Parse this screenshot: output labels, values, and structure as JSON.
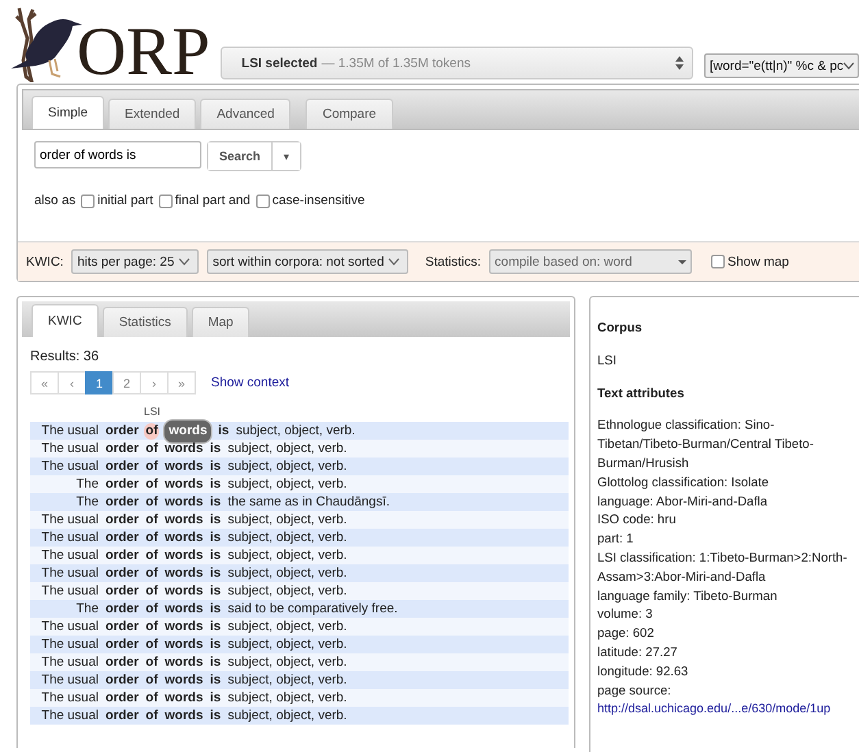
{
  "logo": {
    "text": "ORP"
  },
  "corpus_bar": {
    "selection": "LSI selected",
    "tokens": "— 1.35M of 1.35M tokens"
  },
  "query_select": {
    "value": "[word=\"e(tt|n)\" %c & pc"
  },
  "search_tabs": [
    {
      "label": "Simple",
      "selected": true
    },
    {
      "label": "Extended",
      "selected": false
    },
    {
      "label": "Advanced",
      "selected": false
    },
    {
      "label": "Compare",
      "selected": false
    }
  ],
  "search": {
    "value": "order of words is",
    "button": "Search",
    "caret": "▾"
  },
  "also_as": {
    "label": "also as",
    "options": [
      {
        "label": "initial part",
        "checked": false
      },
      {
        "label": "final part and",
        "checked": false
      },
      {
        "label": "case-insensitive",
        "checked": false
      }
    ]
  },
  "options_bar": {
    "kwic_label": "KWIC:",
    "hits_per_page": "hits per page: 25",
    "sort": "sort within corpora: not sorted",
    "statistics_label": "Statistics:",
    "compile": "compile based on: word",
    "show_map": {
      "label": "Show map",
      "checked": false
    }
  },
  "results_tabs": [
    {
      "label": "KWIC",
      "selected": true
    },
    {
      "label": "Statistics",
      "selected": false
    },
    {
      "label": "Map",
      "selected": false
    }
  ],
  "results": {
    "count": "Results: 36",
    "pages": [
      {
        "label": "«",
        "selected": false
      },
      {
        "label": "‹",
        "selected": false
      },
      {
        "label": "1",
        "selected": true
      },
      {
        "label": "2",
        "selected": false
      },
      {
        "label": "›",
        "selected": false
      },
      {
        "label": "»",
        "selected": false
      }
    ],
    "show_context": "Show context",
    "corpus_heading": "LSI",
    "rows": [
      {
        "left": "The usual",
        "match": [
          {
            "text": "order",
            "hovered": false,
            "selected": false
          },
          {
            "text": "of",
            "hovered": true,
            "selected": false
          },
          {
            "text": "words",
            "hovered": false,
            "selected": true
          },
          {
            "text": "is",
            "hovered": false,
            "selected": false
          }
        ],
        "right": "subject, object, verb."
      },
      {
        "left": "The usual",
        "match": [
          {
            "text": "order",
            "hovered": false,
            "selected": false
          },
          {
            "text": "of",
            "hovered": false,
            "selected": false
          },
          {
            "text": "words",
            "hovered": false,
            "selected": false
          },
          {
            "text": "is",
            "hovered": false,
            "selected": false
          }
        ],
        "right": "subject, object, verb."
      },
      {
        "left": "The usual",
        "match": [
          {
            "text": "order",
            "hovered": false,
            "selected": false
          },
          {
            "text": "of",
            "hovered": false,
            "selected": false
          },
          {
            "text": "words",
            "hovered": false,
            "selected": false
          },
          {
            "text": "is",
            "hovered": false,
            "selected": false
          }
        ],
        "right": "subject, object, verb."
      },
      {
        "left": "The",
        "match": [
          {
            "text": "order",
            "hovered": false,
            "selected": false
          },
          {
            "text": "of",
            "hovered": false,
            "selected": false
          },
          {
            "text": "words",
            "hovered": false,
            "selected": false
          },
          {
            "text": "is",
            "hovered": false,
            "selected": false
          }
        ],
        "right": "subject, object, verb."
      },
      {
        "left": "The",
        "match": [
          {
            "text": "order",
            "hovered": false,
            "selected": false
          },
          {
            "text": "of",
            "hovered": false,
            "selected": false
          },
          {
            "text": "words",
            "hovered": false,
            "selected": false
          },
          {
            "text": "is",
            "hovered": false,
            "selected": false
          }
        ],
        "right": "the same as in Chaudāngsī."
      },
      {
        "left": "The usual",
        "match": [
          {
            "text": "order",
            "hovered": false,
            "selected": false
          },
          {
            "text": "of",
            "hovered": false,
            "selected": false
          },
          {
            "text": "words",
            "hovered": false,
            "selected": false
          },
          {
            "text": "is",
            "hovered": false,
            "selected": false
          }
        ],
        "right": "subject, object, verb."
      },
      {
        "left": "The usual",
        "match": [
          {
            "text": "order",
            "hovered": false,
            "selected": false
          },
          {
            "text": "of",
            "hovered": false,
            "selected": false
          },
          {
            "text": "words",
            "hovered": false,
            "selected": false
          },
          {
            "text": "is",
            "hovered": false,
            "selected": false
          }
        ],
        "right": "subject, object, verb."
      },
      {
        "left": "The usual",
        "match": [
          {
            "text": "order",
            "hovered": false,
            "selected": false
          },
          {
            "text": "of",
            "hovered": false,
            "selected": false
          },
          {
            "text": "words",
            "hovered": false,
            "selected": false
          },
          {
            "text": "is",
            "hovered": false,
            "selected": false
          }
        ],
        "right": "subject, object, verb."
      },
      {
        "left": "The usual",
        "match": [
          {
            "text": "order",
            "hovered": false,
            "selected": false
          },
          {
            "text": "of",
            "hovered": false,
            "selected": false
          },
          {
            "text": "words",
            "hovered": false,
            "selected": false
          },
          {
            "text": "is",
            "hovered": false,
            "selected": false
          }
        ],
        "right": "subject, object, verb."
      },
      {
        "left": "The usual",
        "match": [
          {
            "text": "order",
            "hovered": false,
            "selected": false
          },
          {
            "text": "of",
            "hovered": false,
            "selected": false
          },
          {
            "text": "words",
            "hovered": false,
            "selected": false
          },
          {
            "text": "is",
            "hovered": false,
            "selected": false
          }
        ],
        "right": "subject, object, verb."
      },
      {
        "left": "The",
        "match": [
          {
            "text": "order",
            "hovered": false,
            "selected": false
          },
          {
            "text": "of",
            "hovered": false,
            "selected": false
          },
          {
            "text": "words",
            "hovered": false,
            "selected": false
          },
          {
            "text": "is",
            "hovered": false,
            "selected": false
          }
        ],
        "right": "said to be comparatively free."
      },
      {
        "left": "The usual",
        "match": [
          {
            "text": "order",
            "hovered": false,
            "selected": false
          },
          {
            "text": "of",
            "hovered": false,
            "selected": false
          },
          {
            "text": "words",
            "hovered": false,
            "selected": false
          },
          {
            "text": "is",
            "hovered": false,
            "selected": false
          }
        ],
        "right": "subject, object, verb."
      },
      {
        "left": "The usual",
        "match": [
          {
            "text": "order",
            "hovered": false,
            "selected": false
          },
          {
            "text": "of",
            "hovered": false,
            "selected": false
          },
          {
            "text": "words",
            "hovered": false,
            "selected": false
          },
          {
            "text": "is",
            "hovered": false,
            "selected": false
          }
        ],
        "right": "subject, object, verb."
      },
      {
        "left": "The usual",
        "match": [
          {
            "text": "order",
            "hovered": false,
            "selected": false
          },
          {
            "text": "of",
            "hovered": false,
            "selected": false
          },
          {
            "text": "words",
            "hovered": false,
            "selected": false
          },
          {
            "text": "is",
            "hovered": false,
            "selected": false
          }
        ],
        "right": "subject, object, verb."
      },
      {
        "left": "The usual",
        "match": [
          {
            "text": "order",
            "hovered": false,
            "selected": false
          },
          {
            "text": "of",
            "hovered": false,
            "selected": false
          },
          {
            "text": "words",
            "hovered": false,
            "selected": false
          },
          {
            "text": "is",
            "hovered": false,
            "selected": false
          }
        ],
        "right": "subject, object, verb."
      },
      {
        "left": "The usual",
        "match": [
          {
            "text": "order",
            "hovered": false,
            "selected": false
          },
          {
            "text": "of",
            "hovered": false,
            "selected": false
          },
          {
            "text": "words",
            "hovered": false,
            "selected": false
          },
          {
            "text": "is",
            "hovered": false,
            "selected": false
          }
        ],
        "right": "subject, object, verb."
      },
      {
        "left": "The usual",
        "match": [
          {
            "text": "order",
            "hovered": false,
            "selected": false
          },
          {
            "text": "of",
            "hovered": false,
            "selected": false
          },
          {
            "text": "words",
            "hovered": false,
            "selected": false
          },
          {
            "text": "is",
            "hovered": false,
            "selected": false
          }
        ],
        "right": "subject, object, verb."
      }
    ]
  },
  "sidebar": {
    "corpus_heading": "Corpus",
    "corpus": "LSI",
    "attributes_heading": "Text attributes",
    "attributes": [
      "Ethnologue classification: Sino-Tibetan/Tibeto-Burman/Central Tibeto-Burman/Hrusish",
      "Glottolog classification: Isolate",
      "language: Abor-Miri-and-Dafla",
      "ISO code: hru",
      "part: 1",
      "LSI classification: 1:Tibeto-Burman>2:North-Assam>3:Abor-Miri-and-Dafla",
      "language family: Tibeto-Burman",
      "volume: 3",
      "page: 602",
      "latitude: 27.27",
      "longitude: 92.63",
      "page source:"
    ],
    "link": "http://dsal.uchicago.edu/...e/630/mode/1up"
  }
}
